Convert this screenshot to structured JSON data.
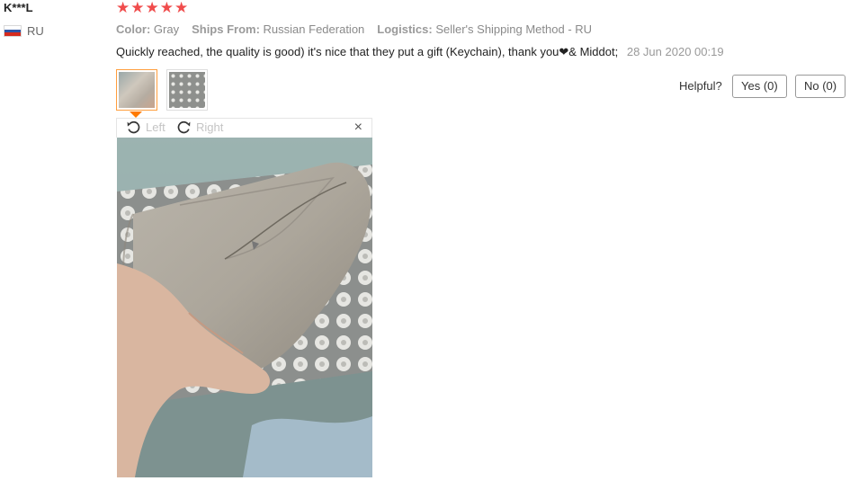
{
  "review": {
    "user_name": "K***L",
    "country_code": "RU",
    "stars": "★★★★★",
    "rating": 5,
    "color_label": "Color:",
    "color_value": "Gray",
    "ships_label": "Ships From:",
    "ships_value": "Russian Federation",
    "logistics_label": "Logistics:",
    "logistics_value": "Seller's Shipping Method - RU",
    "text": "Quickly reached, the quality is good) it's nice that they put a gift (Keychain), thank you❤& Middot;",
    "date": "28 Jun 2020 00:19"
  },
  "helpful": {
    "label": "Helpful?",
    "yes_label": "Yes (0)",
    "no_label": "No (0)"
  },
  "viewer": {
    "rotate_left_label": "Left",
    "rotate_right_label": "Right",
    "close_label": "×"
  },
  "colors": {
    "star": "#f04c4c",
    "thumb_selected_border": "#ff9e3d",
    "pointer": "#ff7a00"
  }
}
